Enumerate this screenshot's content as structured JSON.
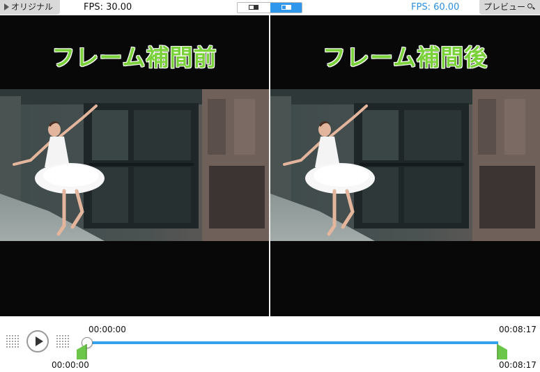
{
  "top_bar": {
    "original_label": "オリジナル",
    "preview_label": "プレビュー",
    "fps_original": "FPS: 30.00",
    "fps_preview": "FPS: 60.00",
    "view_toggle": {
      "selected": "split",
      "options": [
        "single",
        "split"
      ]
    }
  },
  "panes": [
    {
      "title": "フレーム補間前"
    },
    {
      "title": "フレーム補間後"
    }
  ],
  "timeline": {
    "current_time": "00:00:00",
    "end_time": "00:08:17",
    "in_point": "00:00:00",
    "out_point": "00:08:17",
    "progress": 1.0
  },
  "icons": {
    "play": "play-icon",
    "original": "play-triangle-icon",
    "preview": "magnifier-icon",
    "frame_step_back": "dot-grid-icon",
    "frame_step_forward": "dot-grid-icon"
  },
  "colors": {
    "title_green": "#7ad13a",
    "accent_blue": "#2f97ec",
    "marker_green": "#6cc64a",
    "fps_preview": "#2b8fe0"
  }
}
